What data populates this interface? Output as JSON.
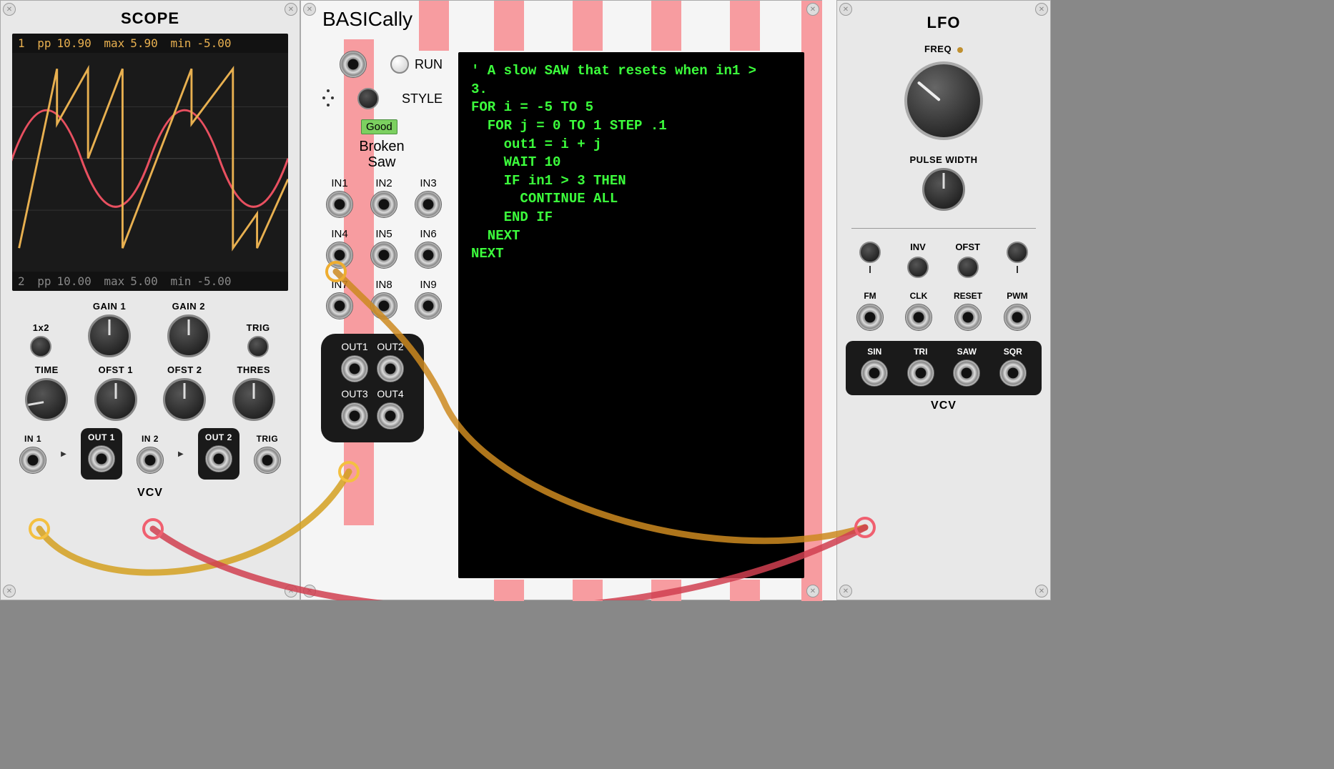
{
  "scope": {
    "title": "SCOPE",
    "readout1": {
      "ch": "1",
      "pp_lbl": "pp",
      "pp": "10.90",
      "max_lbl": "max",
      "max": "5.90",
      "min_lbl": "min",
      "min": "-5.00"
    },
    "readout2": {
      "ch": "2",
      "pp_lbl": "pp",
      "pp": "10.00",
      "max_lbl": "max",
      "max": "5.00",
      "min_lbl": "min",
      "min": "-5.00"
    },
    "labels": {
      "mode": "1x2",
      "gain1": "GAIN 1",
      "gain2": "GAIN 2",
      "trig": "TRIG",
      "time": "TIME",
      "ofst1": "OFST 1",
      "ofst2": "OFST 2",
      "thres": "THRES",
      "in1": "IN 1",
      "out1": "OUT 1",
      "in2": "IN 2",
      "out2": "OUT 2",
      "trigj": "TRIG"
    },
    "brand": "VCV"
  },
  "basically": {
    "title": "BASICally",
    "run": "RUN",
    "style": "STYLE",
    "status": "Good",
    "preset": "Broken\nSaw",
    "ins": [
      "IN1",
      "IN2",
      "IN3",
      "IN4",
      "IN5",
      "IN6",
      "IN7",
      "IN8",
      "IN9"
    ],
    "outs": [
      "OUT1",
      "OUT2",
      "OUT3",
      "OUT4"
    ],
    "code": "' A slow SAW that resets when in1 >\n3.\nFOR i = -5 TO 5\n  FOR j = 0 TO 1 STEP .1\n    out1 = i + j\n    WAIT 10\n    IF in1 > 3 THEN\n      CONTINUE ALL\n    END IF\n  NEXT\nNEXT"
  },
  "lfo": {
    "title": "LFO",
    "freq": "FREQ",
    "pw": "PULSE WIDTH",
    "minis": {
      "inv": "INV",
      "ofst": "OFST"
    },
    "ins": {
      "fm": "FM",
      "clk": "CLK",
      "reset": "RESET",
      "pwm": "PWM"
    },
    "outs": {
      "sin": "SIN",
      "tri": "TRI",
      "saw": "SAW",
      "sqr": "SQR"
    },
    "brand": "VCV"
  }
}
